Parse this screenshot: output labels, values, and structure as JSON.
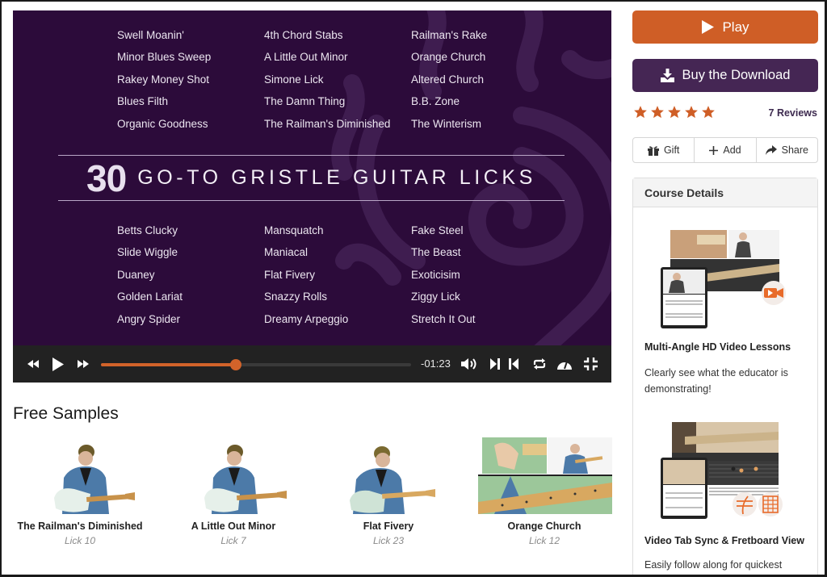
{
  "video": {
    "title_number": "30",
    "title_text": "GO-TO GRISTLE GUITAR LICKS",
    "licks_top": [
      "Swell Moanin'",
      "4th Chord Stabs",
      "Railman's Rake",
      "Minor Blues Sweep",
      "A Little Out Minor",
      "Orange Church",
      "Rakey Money Shot",
      "Simone Lick",
      "Altered Church",
      "Blues Filth",
      "The Damn Thing",
      "B.B. Zone",
      "Organic Goodness",
      "The Railman's Diminished",
      "The Winterism"
    ],
    "licks_bottom": [
      "Betts Clucky",
      "Mansquatch",
      "Fake Steel",
      "Slide Wiggle",
      "Maniacal",
      "The Beast",
      "Duaney",
      "Flat Fivery",
      "Exoticisim",
      "Golden Lariat",
      "Snazzy Rolls",
      "Ziggy Lick",
      "Angry Spider",
      "Dreamy Arpeggio",
      "Stretch It Out"
    ]
  },
  "player": {
    "time_remaining": "-01:23",
    "progress": 0.435,
    "icons": [
      "rewind-icon",
      "play-icon",
      "fast-forward-icon",
      "volume-icon",
      "next-icon",
      "previous-icon",
      "loop-icon",
      "speed-icon",
      "exit-fullscreen-icon"
    ]
  },
  "sidebar": {
    "play_label": "Play",
    "buy_label": "Buy the Download",
    "rating": 5,
    "reviews_label": "7 Reviews",
    "actions": [
      {
        "label": "Gift",
        "icon": "gift-icon"
      },
      {
        "label": "Add",
        "icon": "plus-icon"
      },
      {
        "label": "Share",
        "icon": "share-icon"
      }
    ],
    "details_title": "Course Details",
    "features": [
      {
        "title": "Multi-Angle HD Video Lessons",
        "desc": "Clearly see what the educator is demonstrating!"
      },
      {
        "title": "Video Tab Sync & Fretboard View",
        "desc": "Easily follow along for quickest"
      }
    ]
  },
  "samples": {
    "title": "Free Samples",
    "items": [
      {
        "name": "The Railman's Diminished",
        "lick": "Lick 10"
      },
      {
        "name": "A Little Out Minor",
        "lick": "Lick 7"
      },
      {
        "name": "Flat Fivery",
        "lick": "Lick 23"
      },
      {
        "name": "Orange Church",
        "lick": "Lick 12"
      }
    ]
  },
  "colors": {
    "accent_orange": "#cf5e26",
    "brand_purple": "#452654",
    "video_bg": "#2c0b3a",
    "player_bg": "#222222"
  }
}
